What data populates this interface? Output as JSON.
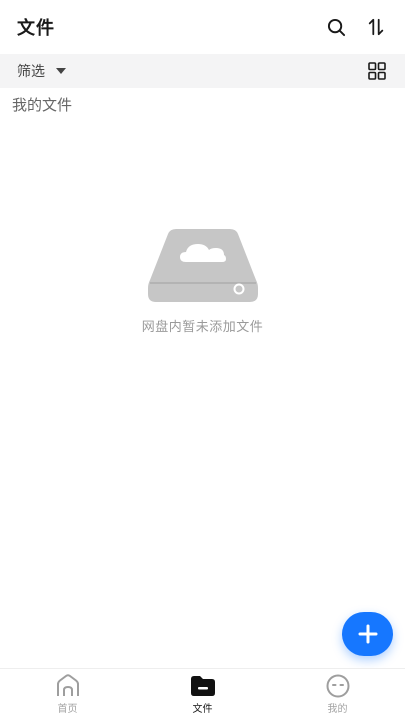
{
  "header": {
    "title": "文件",
    "icons": [
      "search-icon",
      "sort-icon"
    ]
  },
  "filter": {
    "label": "筛选",
    "view_icon": "grid-view-icon"
  },
  "section": {
    "label": "我的文件"
  },
  "empty_state": {
    "message": "网盘内暂未添加文件",
    "icon": "cloud-drive-icon"
  },
  "fab": {
    "icon": "plus-icon",
    "color": "#1677ff"
  },
  "bottom_nav": {
    "items": [
      {
        "label": "首页",
        "icon": "home-icon",
        "active": false
      },
      {
        "label": "文件",
        "icon": "folder-icon",
        "active": true
      },
      {
        "label": "我的",
        "icon": "profile-icon",
        "active": false
      }
    ]
  }
}
